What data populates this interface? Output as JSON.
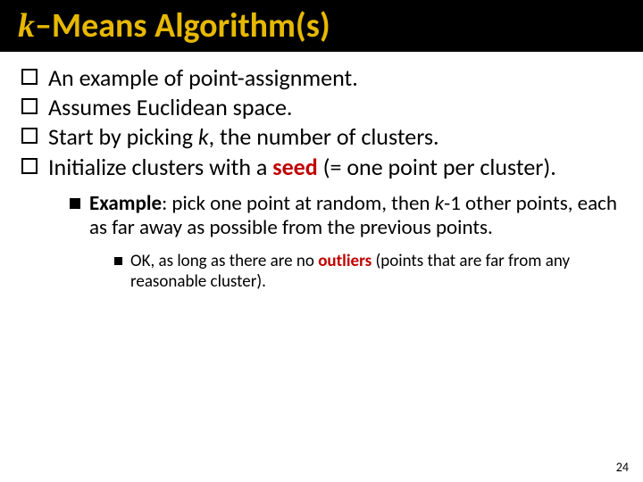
{
  "colors": {
    "title": "#e6b800",
    "accent": "#c00000",
    "titlebar_bg": "#000000"
  },
  "title": {
    "prefix_italic": "k",
    "rest": "–Means Algorithm(s)"
  },
  "bullets": {
    "b1": "An example of point-assignment.",
    "b2": "Assumes Euclidean space.",
    "b3_a": "Start by picking ",
    "b3_k": "k",
    "b3_b": ", the number of clusters.",
    "b4_a": "Initialize clusters with a ",
    "b4_seed": "seed",
    "b4_b": " (= one point per cluster)."
  },
  "sub": {
    "s1_a": "Example",
    "s1_b": ": pick one point at random, then  ",
    "s1_k": "k",
    "s1_c": "-1 other points, each as far away as possible from the previous points."
  },
  "sub2": {
    "t1_a": "OK, as long as there are no ",
    "t1_out": "outliers",
    "t1_b": " (points that are far from any reasonable cluster)."
  },
  "page_number": "24"
}
